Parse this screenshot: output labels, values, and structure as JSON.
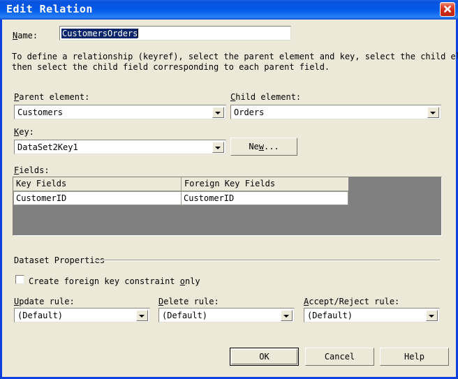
{
  "window": {
    "title": "Edit Relation",
    "close_label": "Close"
  },
  "name_field": {
    "label": "Name:",
    "label_accel": "N",
    "value": "CustomersOrders",
    "placeholder": ""
  },
  "description": {
    "line1": "To define a relationship (keyref), select the parent element and key, select the child element, and",
    "line2": "then select the child field corresponding to each parent field."
  },
  "parent_element": {
    "label": "Parent element:",
    "label_accel": "P",
    "value": "Customers"
  },
  "child_element": {
    "label": "Child element:",
    "label_accel": "C",
    "value": "Orders"
  },
  "key": {
    "label": "Key:",
    "label_accel": "K",
    "value": "DataSet2Key1",
    "new_button": "New...",
    "new_button_accel": "w"
  },
  "fields": {
    "label": "Fields:",
    "label_accel": "F",
    "columns": [
      "Key Fields",
      "Foreign Key Fields"
    ],
    "rows": [
      [
        "CustomerID",
        "CustomerID"
      ]
    ]
  },
  "dataset_properties": {
    "group_label": "Dataset Properties",
    "checkbox": {
      "label": "Create foreign key constraint only",
      "label_accel": "o",
      "checked": false
    },
    "update_rule": {
      "label": "Update rule:",
      "label_accel": "U",
      "value": "(Default)"
    },
    "delete_rule": {
      "label": "Delete rule:",
      "label_accel": "D",
      "value": "(Default)"
    },
    "accept_reject_rule": {
      "label": "Accept/Reject rule:",
      "label_accel": "A",
      "value": "(Default)"
    }
  },
  "buttons": {
    "ok": "OK",
    "cancel": "Cancel",
    "help": "Help"
  },
  "colors": {
    "title_bar": "#0b54dd",
    "dialog_face": "#ece9d8",
    "selection": "#0a246a",
    "grid_empty": "#808080",
    "close_red": "#cf2a14"
  }
}
